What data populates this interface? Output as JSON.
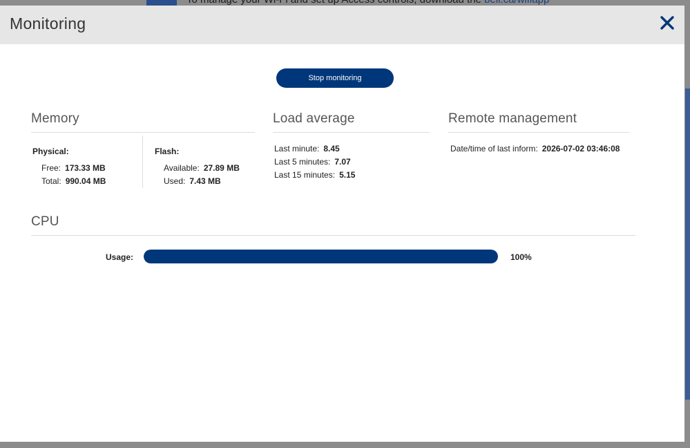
{
  "background": {
    "banner_text": "To manage your Wi-Fi and set up Access controls, download the",
    "banner_link": "bell.ca/wifiapp"
  },
  "modal": {
    "title": "Monitoring",
    "close_icon": "close-icon",
    "stop_button_label": "Stop monitoring"
  },
  "memory": {
    "title": "Memory",
    "physical": {
      "label": "Physical:",
      "free_label": "Free:",
      "free_value": "173.33 MB",
      "total_label": "Total:",
      "total_value": "990.04 MB"
    },
    "flash": {
      "label": "Flash:",
      "available_label": "Available:",
      "available_value": "27.89 MB",
      "used_label": "Used:",
      "used_value": "7.43 MB"
    }
  },
  "load_average": {
    "title": "Load average",
    "last_minute_label": "Last minute:",
    "last_minute_value": "8.45",
    "last_5_label": "Last 5 minutes:",
    "last_5_value": "7.07",
    "last_15_label": "Last 15 minutes:",
    "last_15_value": "5.15"
  },
  "remote_management": {
    "title": "Remote management",
    "last_inform_label": "Date/time of last inform:",
    "last_inform_value": "2026-07-02 03:46:08"
  },
  "cpu": {
    "title": "CPU",
    "usage_label": "Usage:",
    "usage_percent": 100,
    "usage_text": "100%"
  },
  "colors": {
    "accent": "#00367a",
    "header_bg": "#e6e6e6"
  }
}
